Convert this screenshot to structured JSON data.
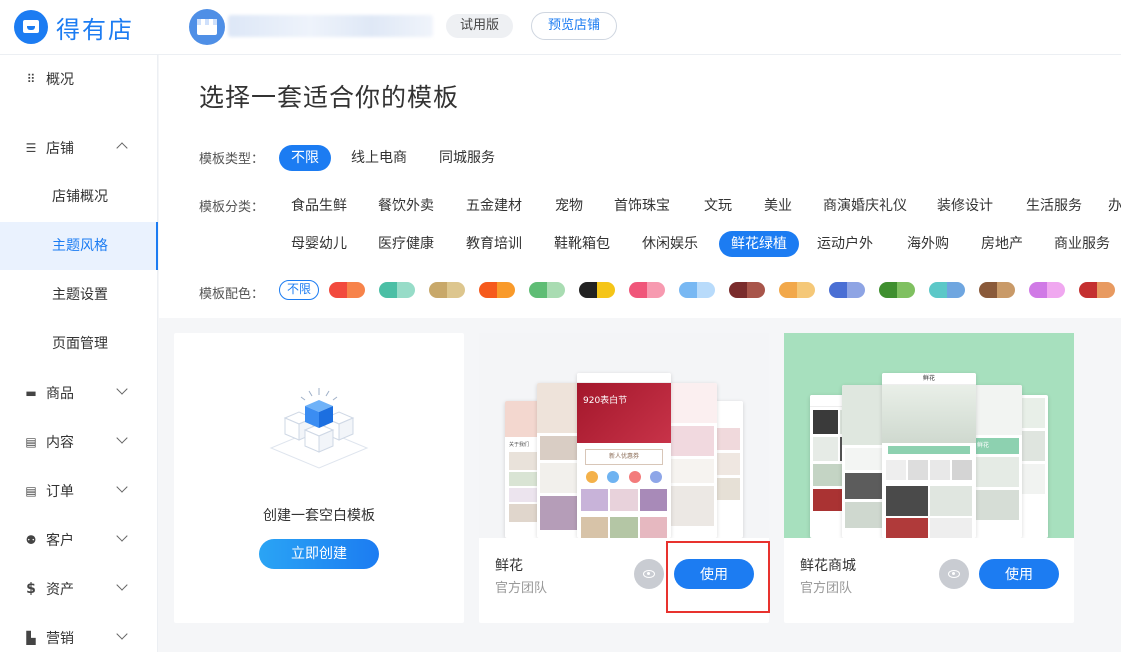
{
  "header": {
    "brand": "得有店",
    "trial_label": "试用版",
    "preview_label": "预览店铺"
  },
  "sidebar": {
    "overview": "概况",
    "store": "店铺",
    "store_sub": [
      "店铺概况",
      "主题风格",
      "主题设置",
      "页面管理"
    ],
    "goods": "商品",
    "content": "内容",
    "orders": "订单",
    "customers": "客户",
    "assets": "资产",
    "marketing": "营销"
  },
  "main": {
    "title": "选择一套适合你的模板",
    "type_label": "模板类型：",
    "types": [
      "不限",
      "线上电商",
      "同城服务"
    ],
    "category_label": "模板分类：",
    "categories_row1": [
      "食品生鲜",
      "餐饮外卖",
      "五金建材",
      "宠物",
      "首饰珠宝",
      "文玩",
      "美业",
      "商演婚庆礼仪",
      "装修设计",
      "生活服务",
      "办"
    ],
    "categories_row2": [
      "母婴幼儿",
      "医疗健康",
      "教育培训",
      "鞋靴箱包",
      "休闲娱乐",
      "鲜花绿植",
      "运动户外",
      "海外购",
      "房地产",
      "商业服务"
    ],
    "color_label": "模板配色：",
    "color_none": "不限",
    "color_swatches": [
      [
        "#f24a3d",
        "#f7834a"
      ],
      [
        "#4bbfa5",
        "#97dcc8"
      ],
      [
        "#c8a86a",
        "#ddc68e"
      ],
      [
        "#f65a1c",
        "#f99a2a"
      ],
      [
        "#5fbd75",
        "#a9dcb2"
      ],
      [
        "#222222",
        "#f5c518"
      ],
      [
        "#f0567a",
        "#f79ab0"
      ],
      [
        "#78b8f3",
        "#b8dbfb"
      ],
      [
        "#7a2c2c",
        "#a8554a"
      ],
      [
        "#f2a84a",
        "#f5c878"
      ],
      [
        "#4a6fd4",
        "#8ea4e4"
      ],
      [
        "#3f8f2f",
        "#7fc060"
      ],
      [
        "#5cc8c8",
        "#6fa6e0"
      ],
      [
        "#8a5a3a",
        "#c99a68"
      ],
      [
        "#d07ae6",
        "#f0a8f0"
      ],
      [
        "#c43030",
        "#e89a60"
      ]
    ]
  },
  "cards": {
    "blank": {
      "label": "创建一套空白模板",
      "button": "立即创建"
    },
    "flower": {
      "name": "鲜花",
      "team": "官方团队",
      "button": "使用",
      "phone_banner": "920表白节",
      "phone_section": "关于我们",
      "phone_cta": "新人优惠券"
    },
    "mall": {
      "name": "鲜花商城",
      "team": "官方团队",
      "button": "使用",
      "phone_title": "鲜花",
      "phone_tab": "鲜花"
    }
  }
}
